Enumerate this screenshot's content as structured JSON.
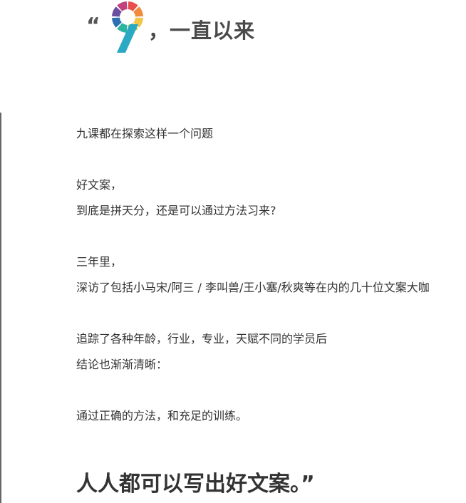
{
  "header": {
    "open_quote": "“",
    "logo_name": "nine-color-wheel-logo",
    "title": "，一直以来"
  },
  "body": {
    "p1": "九课都在探索这样一个问题",
    "p2": "好文案，",
    "p3": "到底是拼天分，还是可以通过方法习来?",
    "p4": "三年里，",
    "p5": "深访了包括小马宋/阿三 / 李叫兽/王小塞/秋爽等在内的几十位文案大咖",
    "p6": "追踪了各种年龄，行业，专业，天赋不同的学员后",
    "p7": "结论也渐渐清晰：",
    "p8": "通过正确的方法，和充足的训练。"
  },
  "closing": {
    "text": "人人都可以写出好文案。”"
  },
  "colors": {
    "text": "#333333",
    "logo_segments": [
      "#e94e4e",
      "#f08a3c",
      "#f3c64a",
      "#a5c94a",
      "#2bb5a0",
      "#2c6fb5",
      "#6a4fa0",
      "#c2417f"
    ]
  }
}
